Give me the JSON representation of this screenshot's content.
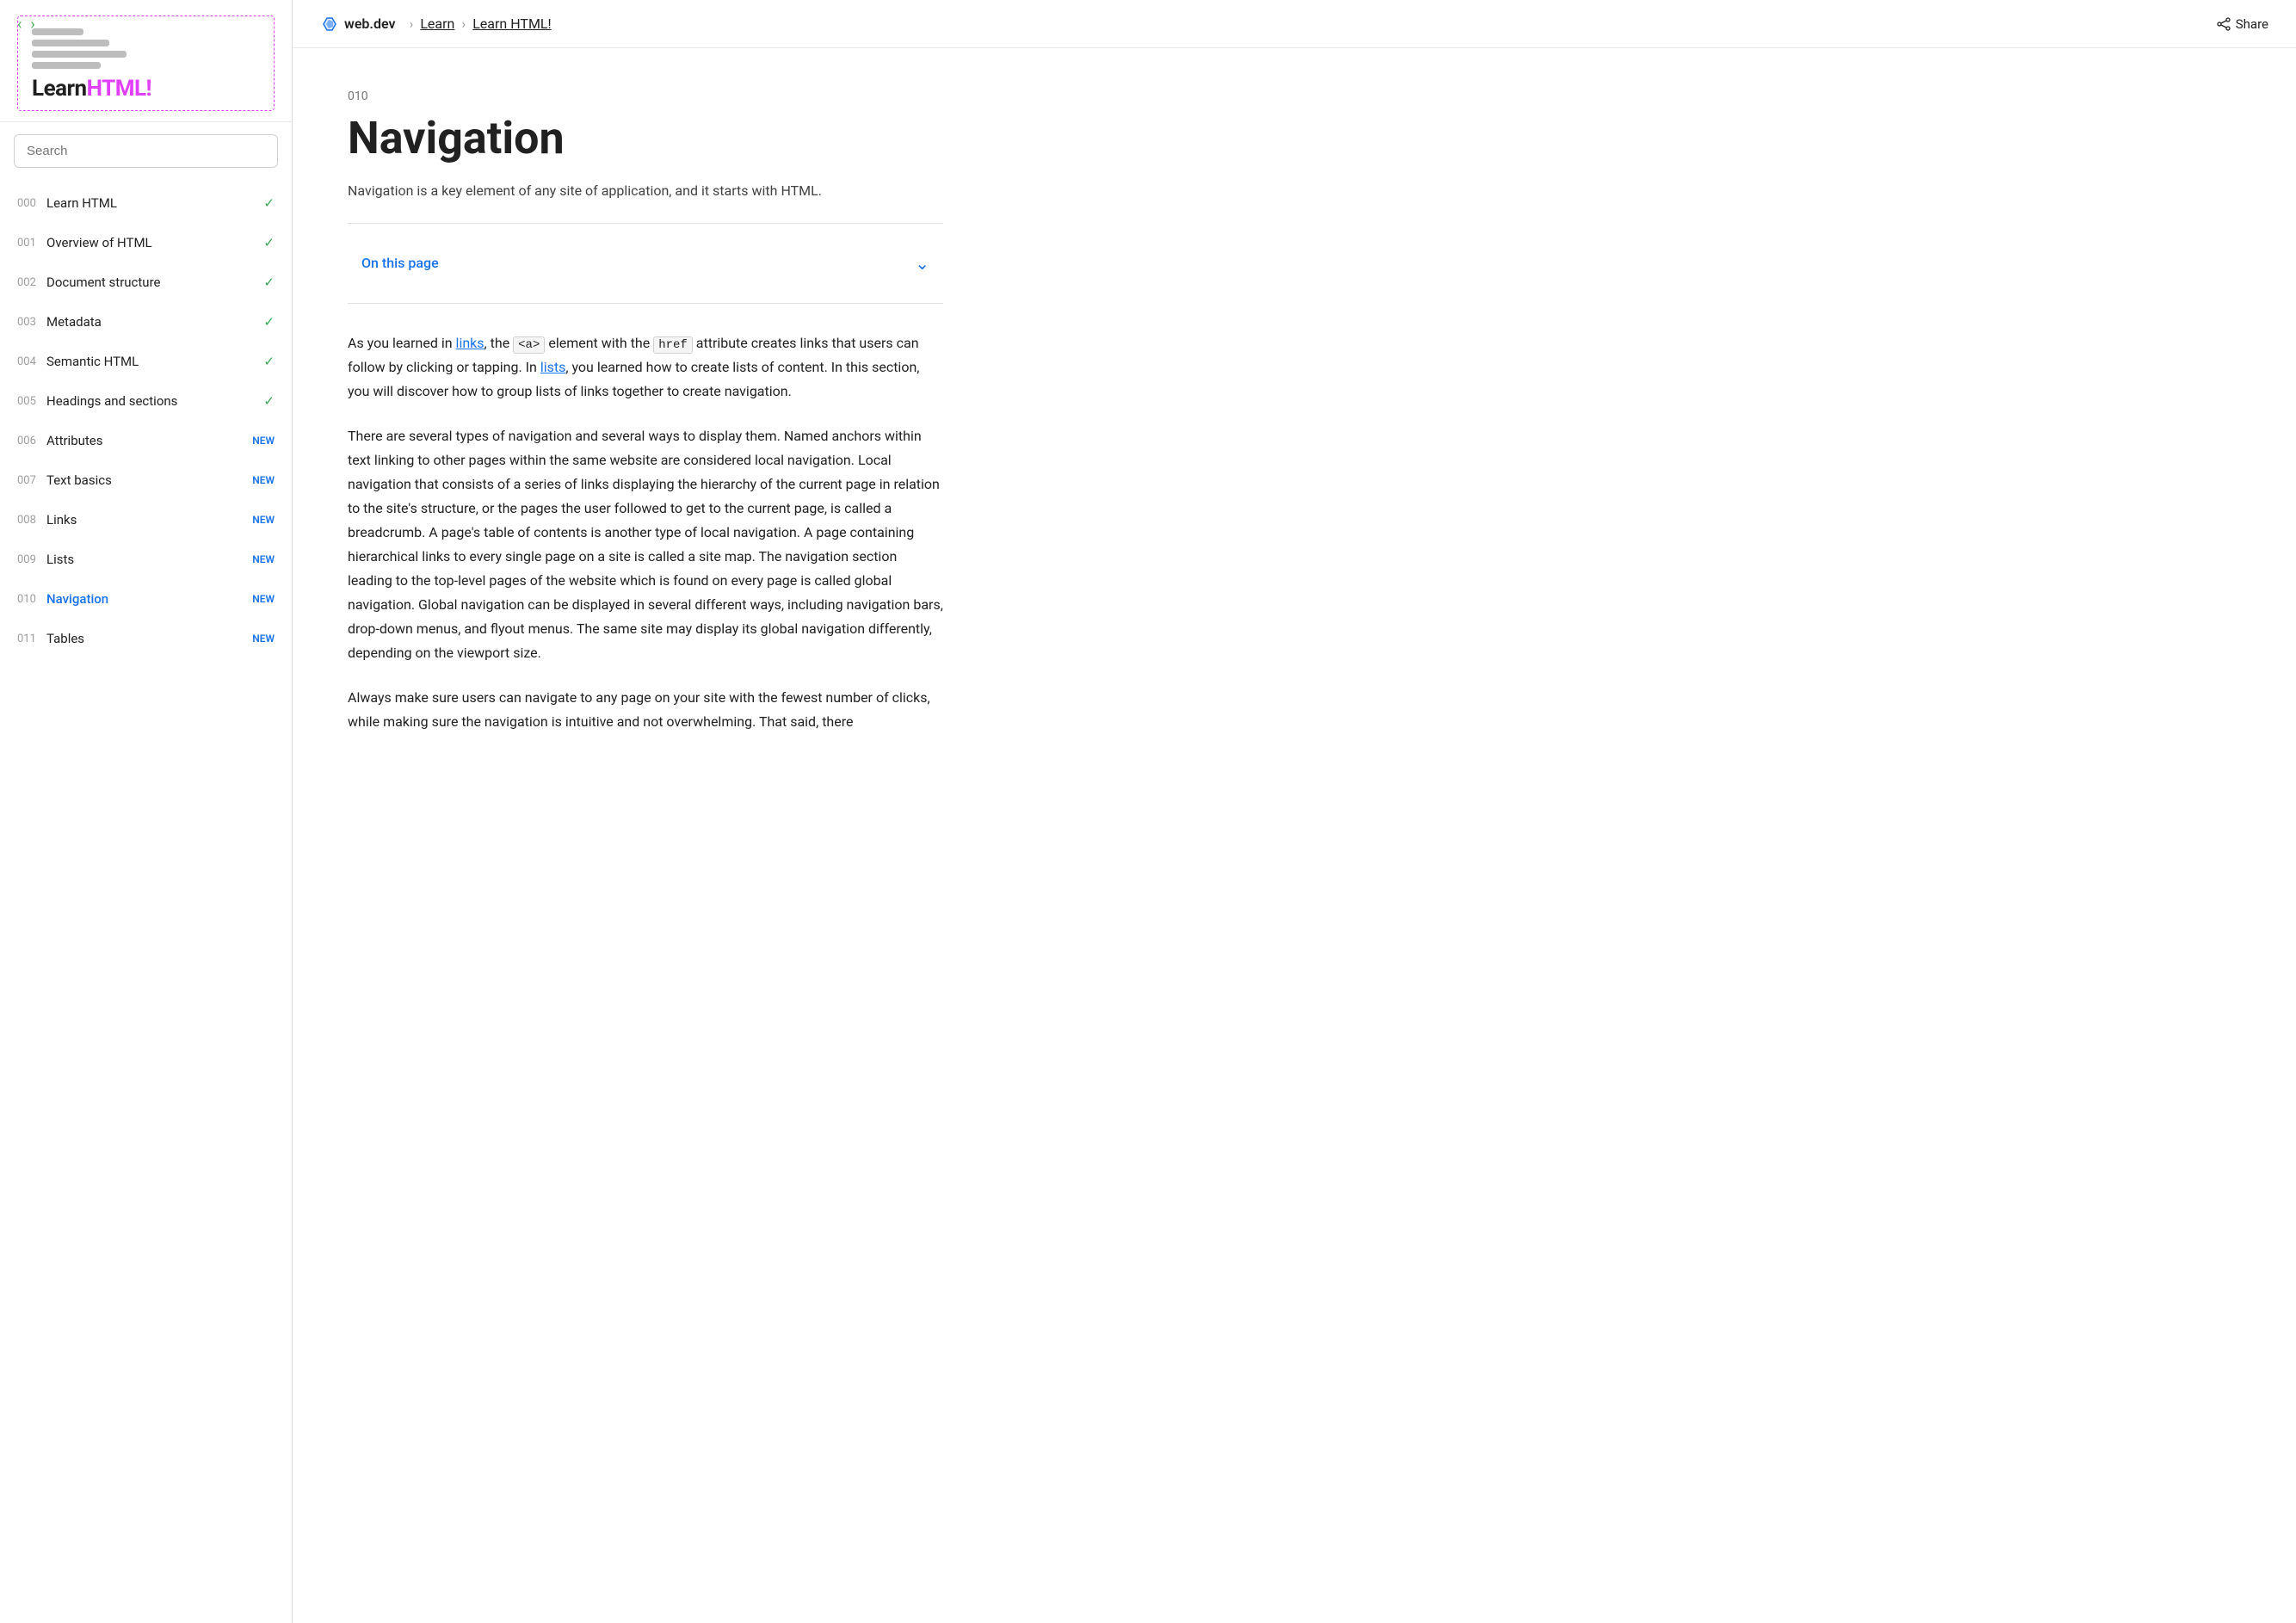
{
  "sidebar": {
    "logo": {
      "learn_part": "Learn",
      "html_part": "HTML!"
    },
    "search_placeholder": "Search",
    "nav_items": [
      {
        "number": "000",
        "label": "Learn HTML",
        "badge": "check",
        "active": false
      },
      {
        "number": "001",
        "label": "Overview of HTML",
        "badge": "check",
        "active": false
      },
      {
        "number": "002",
        "label": "Document structure",
        "badge": "check",
        "active": false
      },
      {
        "number": "003",
        "label": "Metadata",
        "badge": "check",
        "active": false
      },
      {
        "number": "004",
        "label": "Semantic HTML",
        "badge": "check",
        "active": false
      },
      {
        "number": "005",
        "label": "Headings and sections",
        "badge": "check",
        "active": false
      },
      {
        "number": "006",
        "label": "Attributes",
        "badge": "NEW",
        "active": false
      },
      {
        "number": "007",
        "label": "Text basics",
        "badge": "NEW",
        "active": false
      },
      {
        "number": "008",
        "label": "Links",
        "badge": "NEW",
        "active": false
      },
      {
        "number": "009",
        "label": "Lists",
        "badge": "NEW",
        "active": false
      },
      {
        "number": "010",
        "label": "Navigation",
        "badge": "NEW",
        "active": true
      },
      {
        "number": "011",
        "label": "Tables",
        "badge": "NEW",
        "active": false
      }
    ]
  },
  "topbar": {
    "site_name": "web.dev",
    "breadcrumb_1": "Learn",
    "breadcrumb_2": "Learn HTML!",
    "share_label": "Share"
  },
  "article": {
    "number": "010",
    "title": "Navigation",
    "subtitle": "Navigation is a key element of any site of application, and it starts with HTML.",
    "on_this_page": "On this page",
    "paragraphs": [
      {
        "id": "p1",
        "parts": [
          {
            "type": "text",
            "content": "As you learned in "
          },
          {
            "type": "link",
            "content": "links"
          },
          {
            "type": "text",
            "content": ", the "
          },
          {
            "type": "code",
            "content": "<a>"
          },
          {
            "type": "text",
            "content": " element with the "
          },
          {
            "type": "code",
            "content": "href"
          },
          {
            "type": "text",
            "content": " attribute creates links that users can follow by clicking or tapping. In "
          },
          {
            "type": "link",
            "content": "lists"
          },
          {
            "type": "text",
            "content": ", you learned how to create lists of content. In this section, you will discover how to group lists of links together to create navigation."
          }
        ]
      },
      {
        "id": "p2",
        "text": "There are several types of navigation and several ways to display them. Named anchors within text linking to other pages within the same website are considered local navigation. Local navigation that consists of a series of links displaying the hierarchy of the current page in relation to the site's structure, or the pages the user followed to get to the current page, is called a breadcrumb. A page's table of contents is another type of local navigation. A page containing hierarchical links to every single page on a site is called a site map. The navigation section leading to the top-level pages of the website which is found on every page is called global navigation. Global navigation can be displayed in several different ways, including navigation bars, drop-down menus, and flyout menus. The same site may display its global navigation differently, depending on the viewport size."
      },
      {
        "id": "p3",
        "text": "Always make sure users can navigate to any page on your site with the fewest number of clicks, while making sure the navigation is intuitive and not overwhelming. That said, there"
      }
    ]
  }
}
